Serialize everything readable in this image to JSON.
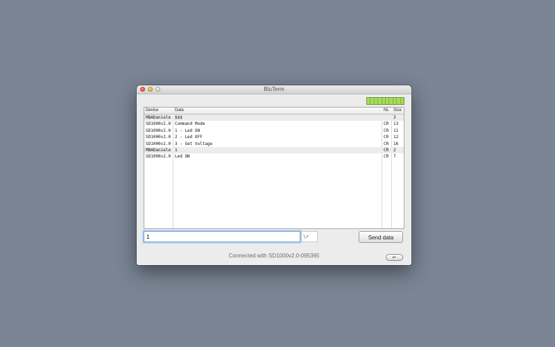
{
  "window": {
    "title": "BluTerm"
  },
  "table": {
    "headers": {
      "device": "Device",
      "data": "Data",
      "nl": "NL",
      "size": "Size"
    },
    "rows": [
      {
        "device": "MBADaniele",
        "data": "$$$",
        "nl": "",
        "size": "3",
        "highlight": true
      },
      {
        "device": "SD1000v2.0",
        "data": "Command Mode",
        "nl": "CR",
        "size": "13",
        "highlight": false
      },
      {
        "device": "SD1000v2.0",
        "data": "1 - Led ON",
        "nl": "CR",
        "size": "11",
        "highlight": false
      },
      {
        "device": "SD1000v2.0",
        "data": "2 - Led OFF",
        "nl": "CR",
        "size": "12",
        "highlight": false
      },
      {
        "device": "SD1000v2.0",
        "data": "3 - Set Voltage",
        "nl": "CR",
        "size": "16",
        "highlight": false
      },
      {
        "device": "MBADaniele",
        "data": "1",
        "nl": "CR",
        "size": "2",
        "highlight": true
      },
      {
        "device": "SD1000v2.0",
        "data": "Led ON",
        "nl": "CR",
        "size": "7",
        "highlight": false
      }
    ]
  },
  "input": {
    "value": "1",
    "terminator": "\\r"
  },
  "send_button": {
    "label": "Send data"
  },
  "status": {
    "text": "Connected with SD1000v2.0-095365"
  },
  "enter_button": {
    "label": "↵"
  },
  "signal": {
    "segments": 10,
    "level": 1.0,
    "color": "#a7d95d"
  }
}
